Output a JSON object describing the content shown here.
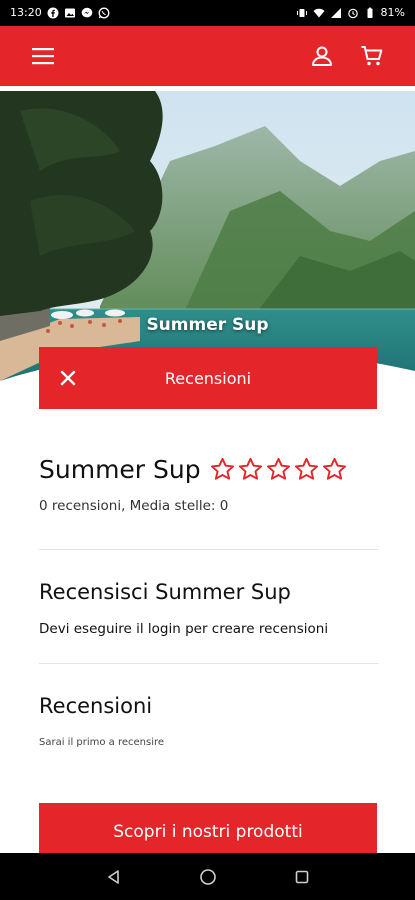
{
  "status_bar": {
    "time": "13:20",
    "battery": "81%",
    "left_icons": [
      "facebook-icon",
      "gallery-icon",
      "messenger-icon",
      "whatsapp-icon"
    ],
    "right_icons": [
      "vibrate-icon",
      "wifi-icon",
      "signal-icon",
      "alarm-icon",
      "battery-icon"
    ]
  },
  "header": {
    "color": "#e4262b",
    "icons": [
      "menu-icon",
      "user-icon",
      "cart-icon"
    ]
  },
  "hero": {
    "title": "Summer Sup"
  },
  "reviews_bar": {
    "label": "Recensioni",
    "close_icon": "close-icon"
  },
  "product": {
    "title": "Summer Sup",
    "rating_stars": 0,
    "max_stars": 5,
    "summary": "0 recensioni, Media stelle: 0"
  },
  "write_review": {
    "title": "Recensisci Summer Sup",
    "message": "Devi eseguire il login per creare recensioni"
  },
  "reviews": {
    "title": "Recensioni",
    "empty_message": "Sarai il primo a recensire"
  },
  "cta": {
    "label": "Scopri i nostri prodotti"
  },
  "nav": {
    "icons": [
      "back-icon",
      "home-icon",
      "recents-icon"
    ]
  },
  "colors": {
    "accent": "#e4262b",
    "text": "#111111"
  }
}
